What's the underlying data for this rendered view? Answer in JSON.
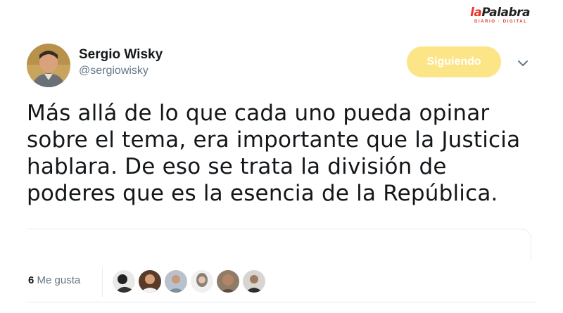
{
  "brand": {
    "name_prefix": "la",
    "name_rest": "Palabra",
    "tagline": "DIARIO · DIGITAL"
  },
  "author": {
    "name": "Sergio Wisky",
    "handle": "@sergiowisky"
  },
  "follow_button": {
    "label": "Siguiendo"
  },
  "tweet": {
    "text": "Más allá de lo que cada uno pueda opinar sobre el tema, era importante que la Justicia hablara. De eso se trata la división de poderes que es la esencia de la República."
  },
  "stats": {
    "likes_count": "6",
    "likes_label": "Me gusta"
  },
  "colors": {
    "follow_bg": "#fce586",
    "brand_red": "#e8352c",
    "handle_gray": "#657786"
  }
}
